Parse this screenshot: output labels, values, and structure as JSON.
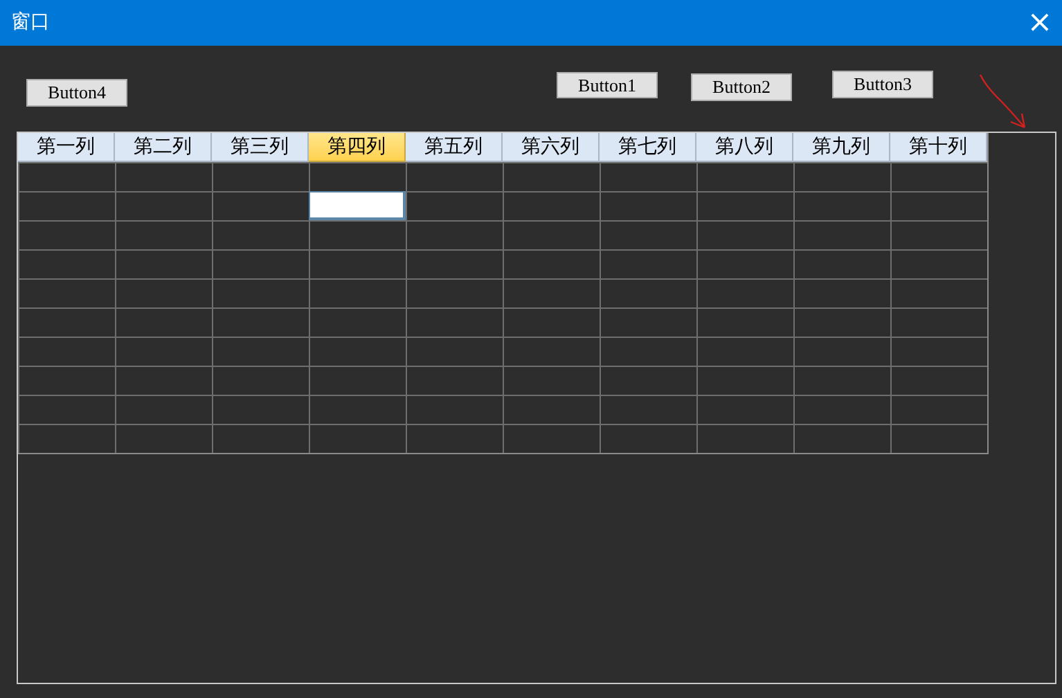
{
  "window": {
    "title": "窗口",
    "close": "×"
  },
  "buttons": [
    {
      "label": "Button4"
    },
    {
      "label": "Button1"
    },
    {
      "label": "Button2"
    },
    {
      "label": "Button3"
    }
  ],
  "table": {
    "columns": [
      {
        "label": "第一列",
        "selected": false
      },
      {
        "label": "第二列",
        "selected": false
      },
      {
        "label": "第三列",
        "selected": false
      },
      {
        "label": "第四列",
        "selected": true
      },
      {
        "label": "第五列",
        "selected": false
      },
      {
        "label": "第六列",
        "selected": false
      },
      {
        "label": "第七列",
        "selected": false
      },
      {
        "label": "第八列",
        "selected": false
      },
      {
        "label": "第九列",
        "selected": false
      },
      {
        "label": "第十列",
        "selected": false
      }
    ],
    "rows": [
      {
        "cells": [
          {
            "editing": false
          },
          {
            "editing": false
          },
          {
            "editing": false
          },
          {
            "editing": false
          },
          {
            "editing": false
          },
          {
            "editing": false
          },
          {
            "editing": false
          },
          {
            "editing": false
          },
          {
            "editing": false
          },
          {
            "editing": false
          }
        ]
      },
      {
        "cells": [
          {
            "editing": false
          },
          {
            "editing": false
          },
          {
            "editing": false
          },
          {
            "editing": true
          },
          {
            "editing": false
          },
          {
            "editing": false
          },
          {
            "editing": false
          },
          {
            "editing": false
          },
          {
            "editing": false
          },
          {
            "editing": false
          }
        ]
      },
      {
        "cells": [
          {
            "editing": false
          },
          {
            "editing": false
          },
          {
            "editing": false
          },
          {
            "editing": false
          },
          {
            "editing": false
          },
          {
            "editing": false
          },
          {
            "editing": false
          },
          {
            "editing": false
          },
          {
            "editing": false
          },
          {
            "editing": false
          }
        ]
      },
      {
        "cells": [
          {
            "editing": false
          },
          {
            "editing": false
          },
          {
            "editing": false
          },
          {
            "editing": false
          },
          {
            "editing": false
          },
          {
            "editing": false
          },
          {
            "editing": false
          },
          {
            "editing": false
          },
          {
            "editing": false
          },
          {
            "editing": false
          }
        ]
      },
      {
        "cells": [
          {
            "editing": false
          },
          {
            "editing": false
          },
          {
            "editing": false
          },
          {
            "editing": false
          },
          {
            "editing": false
          },
          {
            "editing": false
          },
          {
            "editing": false
          },
          {
            "editing": false
          },
          {
            "editing": false
          },
          {
            "editing": false
          }
        ]
      },
      {
        "cells": [
          {
            "editing": false
          },
          {
            "editing": false
          },
          {
            "editing": false
          },
          {
            "editing": false
          },
          {
            "editing": false
          },
          {
            "editing": false
          },
          {
            "editing": false
          },
          {
            "editing": false
          },
          {
            "editing": false
          },
          {
            "editing": false
          }
        ]
      },
      {
        "cells": [
          {
            "editing": false
          },
          {
            "editing": false
          },
          {
            "editing": false
          },
          {
            "editing": false
          },
          {
            "editing": false
          },
          {
            "editing": false
          },
          {
            "editing": false
          },
          {
            "editing": false
          },
          {
            "editing": false
          },
          {
            "editing": false
          }
        ]
      },
      {
        "cells": [
          {
            "editing": false
          },
          {
            "editing": false
          },
          {
            "editing": false
          },
          {
            "editing": false
          },
          {
            "editing": false
          },
          {
            "editing": false
          },
          {
            "editing": false
          },
          {
            "editing": false
          },
          {
            "editing": false
          },
          {
            "editing": false
          }
        ]
      },
      {
        "cells": [
          {
            "editing": false
          },
          {
            "editing": false
          },
          {
            "editing": false
          },
          {
            "editing": false
          },
          {
            "editing": false
          },
          {
            "editing": false
          },
          {
            "editing": false
          },
          {
            "editing": false
          },
          {
            "editing": false
          },
          {
            "editing": false
          }
        ]
      },
      {
        "cells": [
          {
            "editing": false
          },
          {
            "editing": false
          },
          {
            "editing": false
          },
          {
            "editing": false
          },
          {
            "editing": false
          },
          {
            "editing": false
          },
          {
            "editing": false
          },
          {
            "editing": false
          },
          {
            "editing": false
          },
          {
            "editing": false
          }
        ]
      }
    ]
  }
}
